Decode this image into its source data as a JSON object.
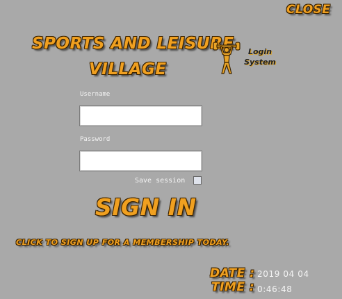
{
  "header": {
    "close_label": "CLOSE"
  },
  "brand": {
    "title_line1": "SPORTS AND LEISURE",
    "title_line2": "VILLAGE",
    "subtitle_line1": "Login",
    "subtitle_line2": "System",
    "logo_icon": "weightlifter-icon"
  },
  "form": {
    "username_label": "Username",
    "username_value": "",
    "password_label": "Password",
    "password_value": "",
    "save_session_label": "Save session",
    "save_session_checked": false,
    "sign_in_label": "SIGN IN"
  },
  "signup": {
    "link_text": "CLICK TO SIGN UP FOR A MEMBERSHIP TODAY."
  },
  "clock": {
    "date_label": "DATE :",
    "date_value": "2019 04 04",
    "time_label": "TIME :",
    "time_value": "0:46:48"
  },
  "colors": {
    "background": "#a9a9a9",
    "accent": "#f0a020",
    "outline": "#3a2200"
  }
}
